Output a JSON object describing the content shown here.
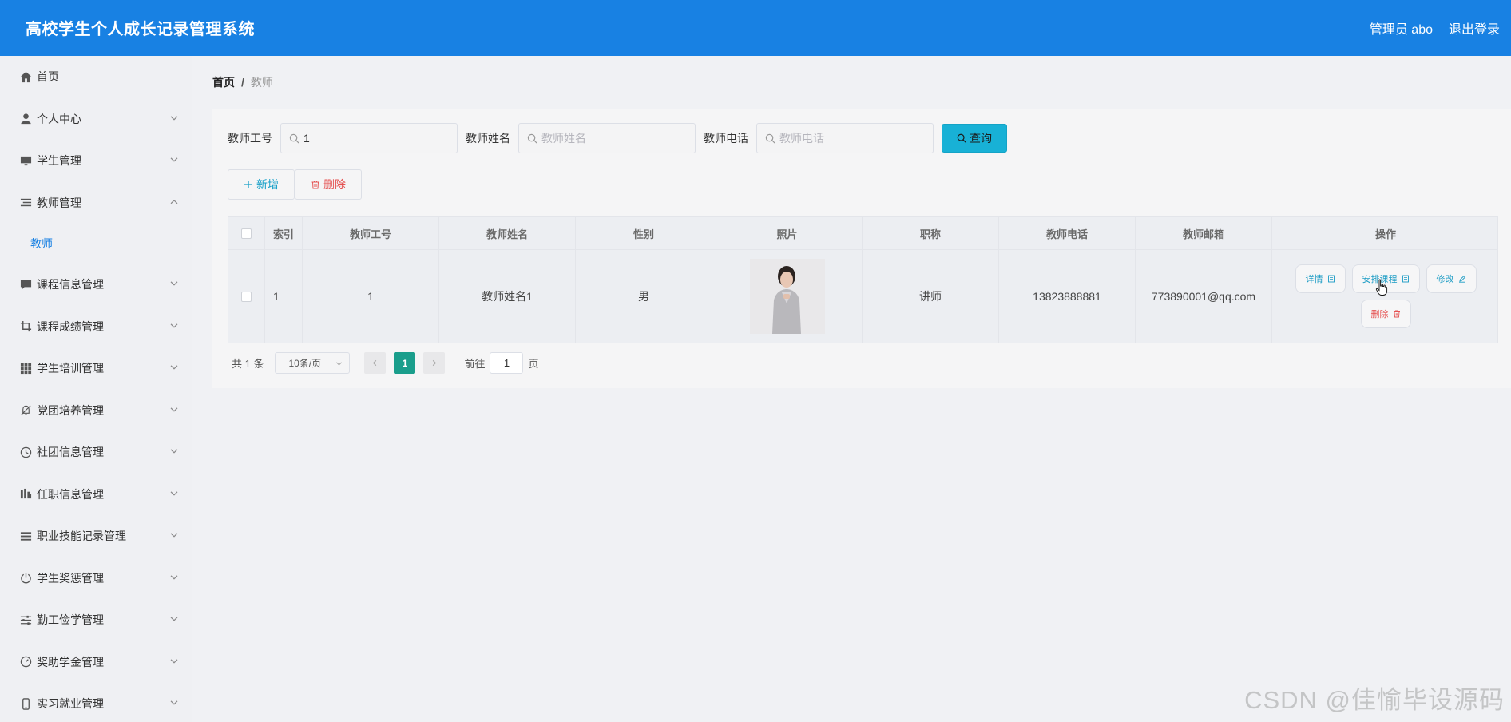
{
  "header": {
    "title": "高校学生个人成长记录管理系统",
    "user": "管理员 abo",
    "logout": "退出登录"
  },
  "sidebar": {
    "items": [
      {
        "label": "首页",
        "icon": "home-icon",
        "expandable": false
      },
      {
        "label": "个人中心",
        "icon": "user-icon",
        "expandable": true
      },
      {
        "label": "学生管理",
        "icon": "monitor-icon",
        "expandable": true
      },
      {
        "label": "教师管理",
        "icon": "list-icon",
        "expandable": true,
        "expanded": true
      },
      {
        "label": "课程信息管理",
        "icon": "chat-icon",
        "expandable": true
      },
      {
        "label": "课程成绩管理",
        "icon": "crop-icon",
        "expandable": true
      },
      {
        "label": "学生培训管理",
        "icon": "grid-icon",
        "expandable": true
      },
      {
        "label": "党团培养管理",
        "icon": "bell-off-icon",
        "expandable": true
      },
      {
        "label": "社团信息管理",
        "icon": "clock-icon",
        "expandable": true
      },
      {
        "label": "任职信息管理",
        "icon": "bar-icon",
        "expandable": true
      },
      {
        "label": "职业技能记录管理",
        "icon": "menu-icon",
        "expandable": true
      },
      {
        "label": "学生奖惩管理",
        "icon": "power-icon",
        "expandable": true
      },
      {
        "label": "勤工俭学管理",
        "icon": "sliders-icon",
        "expandable": true
      },
      {
        "label": "奖助学金管理",
        "icon": "gauge-icon",
        "expandable": true
      },
      {
        "label": "实习就业管理",
        "icon": "phone-icon",
        "expandable": true
      }
    ],
    "submenu": {
      "label": "教师"
    }
  },
  "breadcrumb": {
    "home": "首页",
    "sep": "/",
    "current": "教师"
  },
  "search": {
    "no_label": "教师工号",
    "no_value": "1",
    "name_label": "教师姓名",
    "name_placeholder": "教师姓名",
    "phone_label": "教师电话",
    "phone_placeholder": "教师电话",
    "query": "查询"
  },
  "actions": {
    "add": "新增",
    "delete": "删除"
  },
  "table": {
    "headers": [
      "索引",
      "教师工号",
      "教师姓名",
      "性别",
      "照片",
      "职称",
      "教师电话",
      "教师邮箱",
      "操作"
    ],
    "rows": [
      {
        "index": "1",
        "no": "1",
        "name": "教师姓名1",
        "sex": "男",
        "title": "讲师",
        "phone": "13823888881",
        "email": "773890001@qq.com",
        "ops": {
          "detail": "详情",
          "arrange": "安排课程",
          "edit": "修改",
          "delete": "删除"
        }
      }
    ]
  },
  "pager": {
    "total": "共 1 条",
    "size": "10条/页",
    "page": "1",
    "goto": "前往",
    "goto_value": "1",
    "unit": "页"
  },
  "watermark": "CSDN @佳愉毕设源码",
  "colors": {
    "header": "#1881e3",
    "accent": "#18b1d6",
    "pager_active": "#1a9e8c"
  }
}
